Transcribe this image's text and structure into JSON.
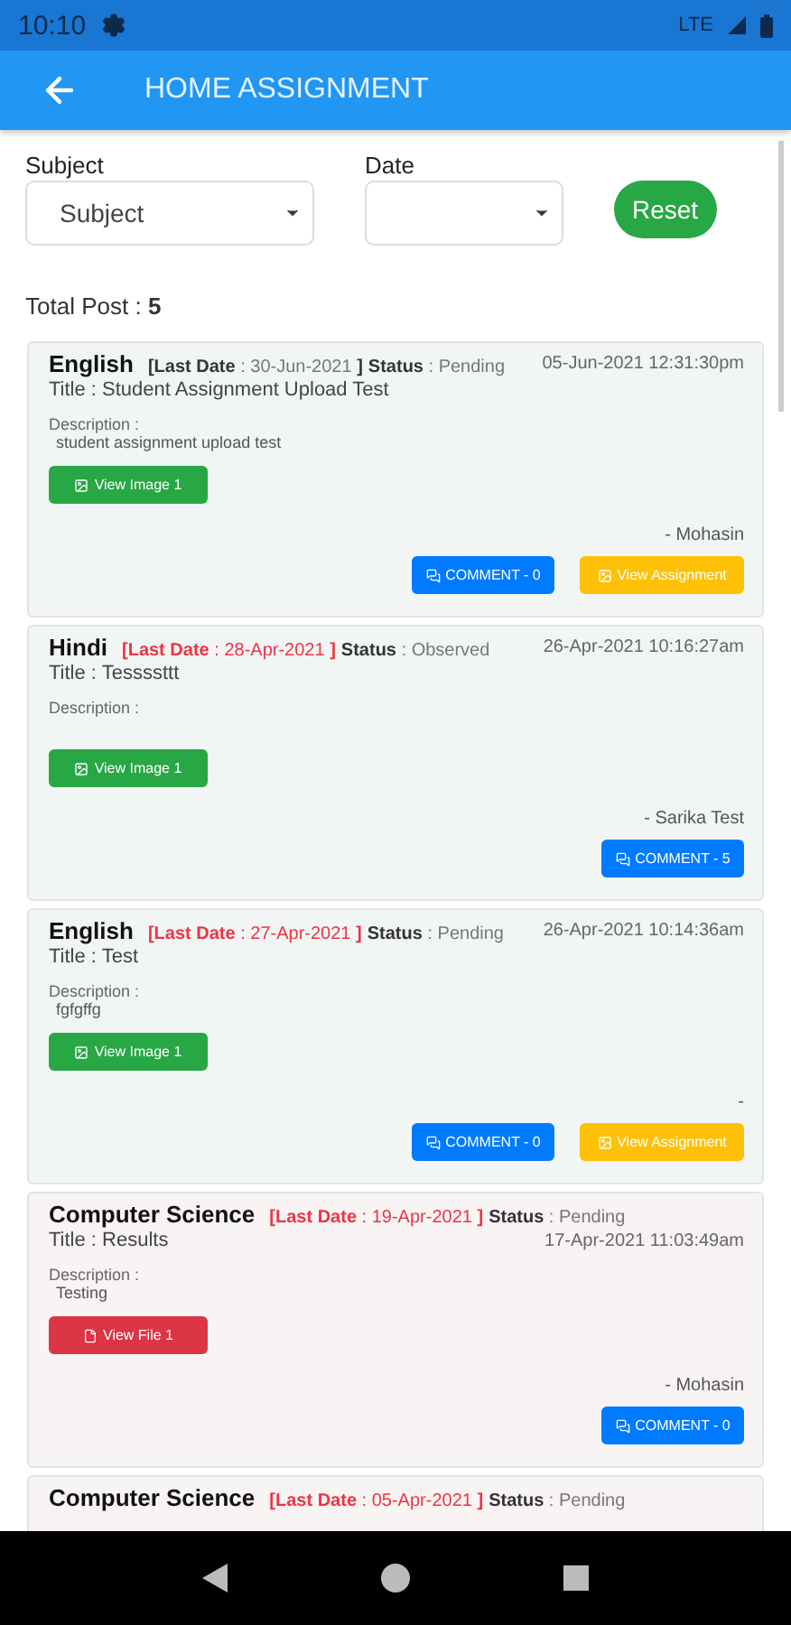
{
  "status_bar": {
    "time": "10:10",
    "network": "LTE"
  },
  "app_bar": {
    "title": "HOME ASSIGNMENT"
  },
  "filters": {
    "subject": {
      "label": "Subject",
      "value": "Subject"
    },
    "date": {
      "label": "Date"
    },
    "reset": "Reset"
  },
  "total": {
    "label": "Total Post :",
    "count": "5"
  },
  "posts": [
    {
      "subject": "English",
      "deadline": "**[Last Date** : 30-Jun-2021 **]**",
      "overdue": false,
      "status": "**Status** : Pending",
      "posted_at": "05-Jun-2021 12:31:30pm",
      "title": "Title : Student Assignment Upload Test",
      "description_label": "Description :",
      "description": "student assignment upload test",
      "attachment": {
        "kind": "image",
        "label": "View Image 1"
      },
      "author": "- Mohasin",
      "comment": "COMMENT - 0",
      "view_assignment": "View Assignment",
      "color": "#f1f6f4"
    },
    {
      "subject": "Hindi",
      "deadline": "**[Last Date** : 28-Apr-2021 **]**",
      "overdue": true,
      "status": "**Status** : Observed",
      "posted_at": "26-Apr-2021 10:16:27am",
      "title": "Title : Tessssttt",
      "description_label": "Description :",
      "attachment": {
        "kind": "image",
        "label": "View Image 1"
      },
      "author": "- Sarika Test",
      "comment": "COMMENT - 5",
      "color": "#f1f6f4"
    },
    {
      "subject": "English",
      "deadline": "**[Last Date** : 27-Apr-2021 **]**",
      "overdue": true,
      "status": "**Status** : Pending",
      "posted_at": "26-Apr-2021 10:14:36am",
      "title": "Title : Test",
      "description_label": "Description :",
      "description": "fgfgffg",
      "attachment": {
        "kind": "image",
        "label": "View Image 1"
      },
      "author": "-",
      "comment": "COMMENT - 0",
      "view_assignment": "View Assignment",
      "color": "#f1f6f4"
    },
    {
      "subject": "Computer Science",
      "deadline": "**[Last Date** : 19-Apr-2021 **]**",
      "overdue": true,
      "status": "**Status** : Pending",
      "posted_at": "17-Apr-2021 11:03:49am",
      "title": "Title : Results",
      "description_label": "Description :",
      "description": "Testing",
      "attachment": {
        "kind": "file",
        "label": "View File 1"
      },
      "author": "- Mohasin",
      "comment": "COMMENT - 0",
      "color": "#f7f4f3"
    },
    {
      "subject": "Computer Science",
      "deadline": "**[Last Date** : 05-Apr-2021 **]**",
      "overdue": true,
      "status": "**Status** : Pending",
      "color": "#f7f4f3"
    }
  ]
}
